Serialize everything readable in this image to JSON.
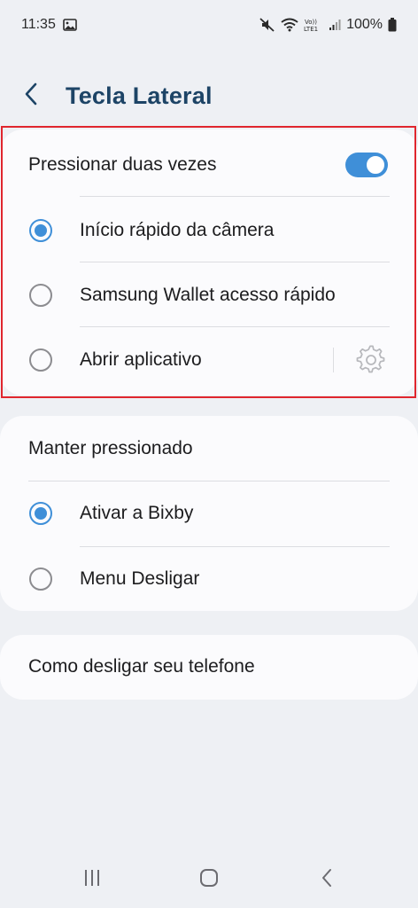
{
  "status_bar": {
    "time": "11:35",
    "battery": "100%",
    "icons": [
      "gallery-icon",
      "mute-icon",
      "wifi-icon",
      "volte-lte-icon",
      "signal-icon",
      "battery-icon"
    ]
  },
  "header": {
    "title": "Tecla Lateral",
    "back_icon": "chevron-left-icon"
  },
  "press_twice": {
    "label": "Pressionar duas vezes",
    "enabled": true,
    "options": [
      {
        "label": "Início rápido da câmera",
        "selected": true
      },
      {
        "label": "Samsung Wallet acesso rápido",
        "selected": false
      },
      {
        "label": "Abrir aplicativo",
        "selected": false,
        "settings_icon": "gear-icon"
      }
    ]
  },
  "hold": {
    "label": "Manter pressionado",
    "options": [
      {
        "label": "Ativar a Bixby",
        "selected": true
      },
      {
        "label": "Menu Desligar",
        "selected": false
      }
    ]
  },
  "power_off_help": {
    "label": "Como desligar seu telefone"
  },
  "colors": {
    "accent": "#3f8fd8",
    "title": "#1d4466",
    "highlight": "#e0262e",
    "background": "#eef0f4",
    "card": "#fbfbfd"
  },
  "navbar": {
    "icons": [
      "recents-icon",
      "home-icon",
      "back-icon"
    ]
  }
}
